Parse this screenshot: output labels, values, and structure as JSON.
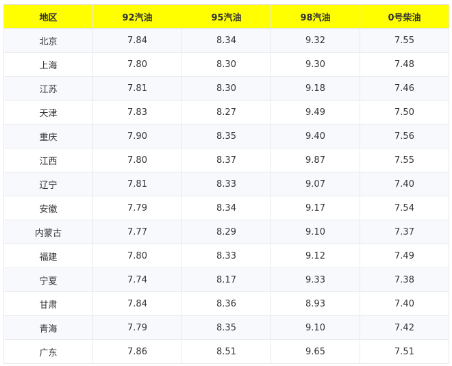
{
  "table": {
    "headers": [
      "地区",
      "92汽油",
      "95汽油",
      "98汽油",
      "0号柴油"
    ],
    "rows": [
      [
        "北京",
        "7.84",
        "8.34",
        "9.32",
        "7.55"
      ],
      [
        "上海",
        "7.80",
        "8.30",
        "9.30",
        "7.48"
      ],
      [
        "江苏",
        "7.81",
        "8.30",
        "9.18",
        "7.46"
      ],
      [
        "天津",
        "7.83",
        "8.27",
        "9.49",
        "7.50"
      ],
      [
        "重庆",
        "7.90",
        "8.35",
        "9.40",
        "7.56"
      ],
      [
        "江西",
        "7.80",
        "8.37",
        "9.87",
        "7.55"
      ],
      [
        "辽宁",
        "7.81",
        "8.33",
        "9.07",
        "7.40"
      ],
      [
        "安徽",
        "7.79",
        "8.34",
        "9.17",
        "7.54"
      ],
      [
        "内蒙古",
        "7.77",
        "8.29",
        "9.10",
        "7.37"
      ],
      [
        "福建",
        "7.80",
        "8.33",
        "9.12",
        "7.49"
      ],
      [
        "宁夏",
        "7.74",
        "8.17",
        "9.33",
        "7.38"
      ],
      [
        "甘肃",
        "7.84",
        "8.36",
        "8.93",
        "7.40"
      ],
      [
        "青海",
        "7.79",
        "8.35",
        "9.10",
        "7.42"
      ],
      [
        "广东",
        "7.86",
        "8.51",
        "9.65",
        "7.51"
      ]
    ]
  },
  "colors": {
    "header_bg": "#ffff00",
    "row_alt_bg": "#f7f9fd",
    "row_bg": "#ffffff",
    "text": "#333333",
    "border": "#e6e9ef"
  }
}
